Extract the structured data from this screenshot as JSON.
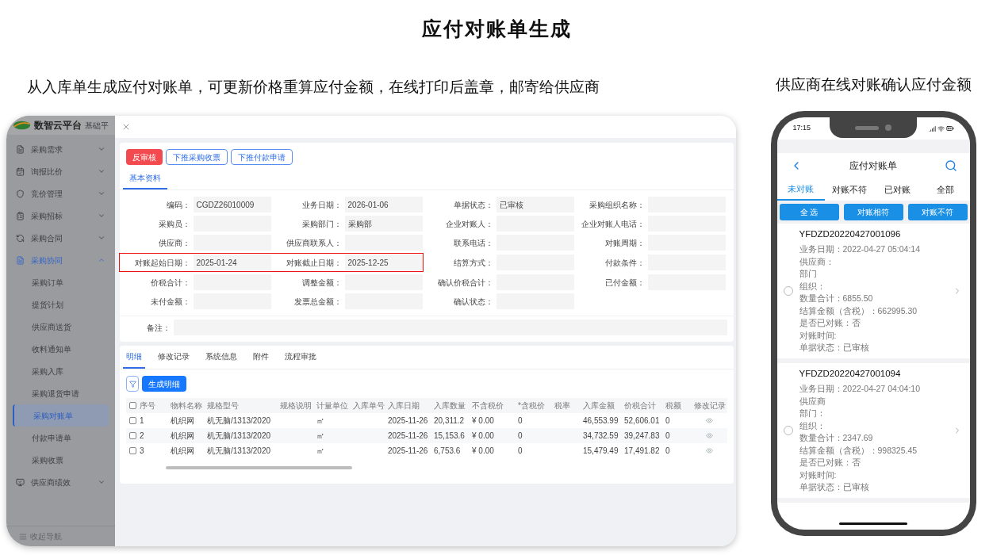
{
  "title": "应付对账单生成",
  "left_caption": "从入库单生成应付对账单，可更新价格重算应付金额，在线打印后盖章，邮寄给供应商",
  "right_caption": "供应商在线对账确认应付金额",
  "desktop": {
    "brand": "数智云平台",
    "top_nav": "基础平",
    "sidebar": [
      {
        "label": "采购需求",
        "expanded": false
      },
      {
        "label": "询报比价",
        "expanded": false
      },
      {
        "label": "竞价管理",
        "expanded": false
      },
      {
        "label": "采购招标",
        "expanded": false
      },
      {
        "label": "采购合同",
        "expanded": false
      },
      {
        "label": "采购协同",
        "expanded": true,
        "children": [
          {
            "label": "采购订单",
            "selected": false
          },
          {
            "label": "提货计划",
            "selected": false
          },
          {
            "label": "供应商送货",
            "selected": false
          },
          {
            "label": "收料通知单",
            "selected": false
          },
          {
            "label": "采购入库",
            "selected": false
          },
          {
            "label": "采购退货申请",
            "selected": false
          },
          {
            "label": "采购对账单",
            "selected": true
          },
          {
            "label": "付款申请单",
            "selected": false
          },
          {
            "label": "采购收票",
            "selected": false
          }
        ]
      },
      {
        "label": "供应商绩效",
        "expanded": false
      }
    ],
    "sidebar_footer": "收起导航",
    "actions": [
      {
        "label": "反审核",
        "kind": "danger"
      },
      {
        "label": "下推采购收票",
        "kind": "outline"
      },
      {
        "label": "下推付款申请",
        "kind": "outline"
      }
    ],
    "tabs": [
      {
        "label": "基本资料",
        "selected": true
      }
    ],
    "form_rows": [
      [
        {
          "label": "编码：",
          "value": "CGDZ26010009"
        },
        {
          "label": "业务日期：",
          "value": "2026-01-06"
        },
        {
          "label": "单据状态：",
          "value": "已审核"
        },
        {
          "label": "采购组织名称："
        }
      ],
      [
        {
          "label": "采购员："
        },
        {
          "label": "采购部门：",
          "value": "采购部"
        },
        {
          "label": "企业对账人："
        },
        {
          "label": "企业对账人电话："
        }
      ],
      [
        {
          "label": "供应商："
        },
        {
          "label": "供应商联系人："
        },
        {
          "label": "联系电话："
        },
        {
          "label": "对账周期："
        }
      ],
      [
        {
          "label": "对账起始日期：",
          "value": "2025-01-24",
          "highlighted": true
        },
        {
          "label": "对账截止日期：",
          "value": "2025-12-25",
          "highlighted": true
        },
        {
          "label": "结算方式："
        },
        {
          "label": "付款条件："
        }
      ],
      [
        {
          "label": "价税合计："
        },
        {
          "label": "调整金额："
        },
        {
          "label": "确认价税合计："
        },
        {
          "label": "已付金额："
        }
      ],
      [
        {
          "label": "未付金额："
        },
        {
          "label": "发票总金额："
        },
        {
          "label": "确认状态："
        }
      ]
    ],
    "remark_label": "备注：",
    "detail_tabs": [
      {
        "label": "明细",
        "selected": true
      },
      {
        "label": "修改记录",
        "selected": false
      },
      {
        "label": "系统信息",
        "selected": false
      },
      {
        "label": "附件",
        "selected": false
      },
      {
        "label": "流程审批",
        "selected": false
      }
    ],
    "generate_button": "生成明细",
    "table": {
      "all_checked": false,
      "columns": [
        "序号",
        "物料名称",
        "规格型号",
        "规格说明",
        "计量单位",
        "入库单号",
        "入库日期",
        "入库数量",
        "不含税价",
        "*含税价",
        "税率",
        "入库金额",
        "价税合计",
        "税额",
        "修改记录"
      ],
      "rows": [
        {
          "checked": false,
          "cells": [
            "1",
            "机织网",
            "机无脑/1313/2020",
            "",
            "㎡",
            "",
            "2025-11-26",
            "20,311.2",
            "¥ 0.00",
            "0",
            "",
            "46,553.99",
            "52,606.01",
            "0"
          ]
        },
        {
          "checked": false,
          "cells": [
            "2",
            "机织网",
            "机无脑/1313/2020",
            "",
            "㎡",
            "",
            "2025-11-26",
            "15,153.6",
            "¥ 0.00",
            "0",
            "",
            "34,732.59",
            "39,247.83",
            "0"
          ]
        },
        {
          "checked": false,
          "cells": [
            "3",
            "机织网",
            "机无脑/1313/2020",
            "",
            "㎡",
            "",
            "2025-11-26",
            "6,753.6",
            "¥ 0.00",
            "0",
            "",
            "15,479.49",
            "17,491.82",
            "0"
          ]
        }
      ]
    }
  },
  "mobile": {
    "time": "17:15",
    "title": "应付对账单",
    "tabs": [
      {
        "label": "未对账",
        "selected": true
      },
      {
        "label": "对账不符",
        "selected": false
      },
      {
        "label": "已对账",
        "selected": false
      },
      {
        "label": "全部",
        "selected": false
      }
    ],
    "buttons": [
      "全 选",
      "对账相符",
      "对账不符"
    ],
    "cards": [
      {
        "id": "YFDZD20220427001096",
        "checked": false,
        "lines": [
          "业务日期：2022-04-27 05:04:14",
          "供应商：",
          "部门",
          "组织：",
          "数量合计：6855.50",
          "结算金额（含税）：662995.30",
          "是否已对账：否",
          "对账时间:",
          "单据状态：已审核"
        ]
      },
      {
        "id": "YFDZD20220427001094",
        "checked": false,
        "lines": [
          "业务日期：2022-04-27 04:04:10",
          "供应商",
          "部门：",
          "组织：",
          "数量合计：2347.69",
          "结算金额（含税）：998325.45",
          "是否已对账：否",
          "对账时间:",
          "单据状态：已审核"
        ]
      }
    ]
  }
}
